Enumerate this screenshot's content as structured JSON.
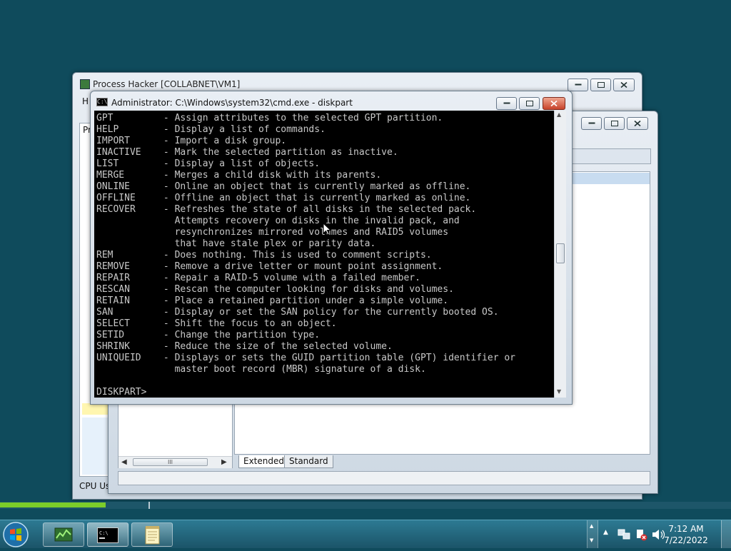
{
  "process_hacker": {
    "title": "Process Hacker [COLLABNET\\VM1]",
    "menu_fragment_1": "H",
    "menu_fragment_2": "Pr",
    "status_text": "CPU Usa"
  },
  "properties_window": {
    "tabs": [
      {
        "label": "Extended"
      },
      {
        "label": "Standard"
      }
    ],
    "hscroll_thumb": "III"
  },
  "cmd_window": {
    "title": "Administrator: C:\\Windows\\system32\\cmd.exe - diskpart",
    "lines": [
      "GPT         - Assign attributes to the selected GPT partition.",
      "HELP        - Display a list of commands.",
      "IMPORT      - Import a disk group.",
      "INACTIVE    - Mark the selected partition as inactive.",
      "LIST        - Display a list of objects.",
      "MERGE       - Merges a child disk with its parents.",
      "ONLINE      - Online an object that is currently marked as offline.",
      "OFFLINE     - Offline an object that is currently marked as online.",
      "RECOVER     - Refreshes the state of all disks in the selected pack.",
      "              Attempts recovery on disks in the invalid pack, and",
      "              resynchronizes mirrored volumes and RAID5 volumes",
      "              that have stale plex or parity data.",
      "REM         - Does nothing. This is used to comment scripts.",
      "REMOVE      - Remove a drive letter or mount point assignment.",
      "REPAIR      - Repair a RAID-5 volume with a failed member.",
      "RESCAN      - Rescan the computer looking for disks and volumes.",
      "RETAIN      - Place a retained partition under a simple volume.",
      "SAN         - Display or set the SAN policy for the currently booted OS.",
      "SELECT      - Shift the focus to an object.",
      "SETID       - Change the partition type.",
      "SHRINK      - Reduce the size of the selected volume.",
      "UNIQUEID    - Displays or sets the GUID partition table (GPT) identifier or",
      "              master boot record (MBR) signature of a disk.",
      "",
      "DISKPART>"
    ]
  },
  "taskbar": {
    "clock_time": "7:12 AM",
    "clock_date": "7/22/2022",
    "buttons": [
      "start-orb",
      "process-hacker",
      "command-prompt",
      "notepad"
    ]
  },
  "colors": {
    "desktop": "#0f4b5c",
    "console_bg": "#000000",
    "console_fg": "#c8c8c8",
    "progress": "#7ccd2a"
  }
}
